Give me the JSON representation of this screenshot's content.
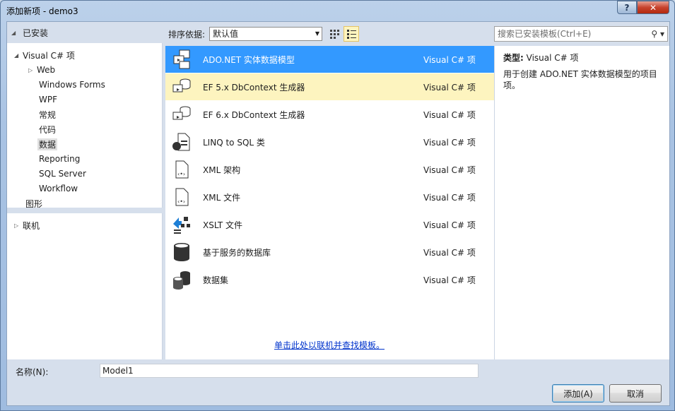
{
  "window": {
    "title": "添加新项 - demo3",
    "help_label": "?",
    "close_label": "✕"
  },
  "left_pane": {
    "header": "已安装",
    "tree": [
      {
        "label": "Visual C# 项",
        "expander": "◢"
      },
      {
        "label": "Web",
        "expander": "▷"
      },
      {
        "label": "Windows Forms"
      },
      {
        "label": "WPF"
      },
      {
        "label": "常规"
      },
      {
        "label": "代码"
      },
      {
        "label": "数据"
      },
      {
        "label": "Reporting"
      },
      {
        "label": "SQL Server"
      },
      {
        "label": "Workflow"
      },
      {
        "label": "图形"
      }
    ],
    "online": {
      "label": "联机",
      "expander": "▷"
    }
  },
  "toolbar": {
    "sort_label": "排序依据:",
    "sort_value": "默认值",
    "search_placeholder": "搜索已安装模板(Ctrl+E)"
  },
  "templates": [
    {
      "name": "ADO.NET 实体数据模型",
      "type": "Visual C# 项",
      "icon": "entity-model-icon",
      "state": "selected"
    },
    {
      "name": "EF 5.x DbContext 生成器",
      "type": "Visual C# 项",
      "icon": "ef-generator-icon",
      "state": "hover"
    },
    {
      "name": "EF 6.x DbContext 生成器",
      "type": "Visual C# 项",
      "icon": "ef-generator-icon",
      "state": ""
    },
    {
      "name": "LINQ to SQL 类",
      "type": "Visual C# 项",
      "icon": "linq-icon",
      "state": ""
    },
    {
      "name": "XML 架构",
      "type": "Visual C# 项",
      "icon": "xml-schema-icon",
      "state": ""
    },
    {
      "name": "XML 文件",
      "type": "Visual C# 项",
      "icon": "xml-file-icon",
      "state": ""
    },
    {
      "name": "XSLT 文件",
      "type": "Visual C# 项",
      "icon": "xslt-icon",
      "state": ""
    },
    {
      "name": "基于服务的数据库",
      "type": "Visual C# 项",
      "icon": "database-icon",
      "state": ""
    },
    {
      "name": "数据集",
      "type": "Visual C# 项",
      "icon": "dataset-icon",
      "state": ""
    }
  ],
  "online_link": "单击此处以联机并查找模板。",
  "details": {
    "type_label": "类型:",
    "type_value": "Visual C# 项",
    "description": "用于创建 ADO.NET 实体数据模型的项目项。"
  },
  "footer": {
    "name_label": "名称(N):",
    "name_value": "Model1",
    "add_label": "添加(A)",
    "cancel_label": "取消"
  },
  "colors": {
    "selection": "#3399ff",
    "hover": "#fdf4bf",
    "link": "#0033cc"
  }
}
